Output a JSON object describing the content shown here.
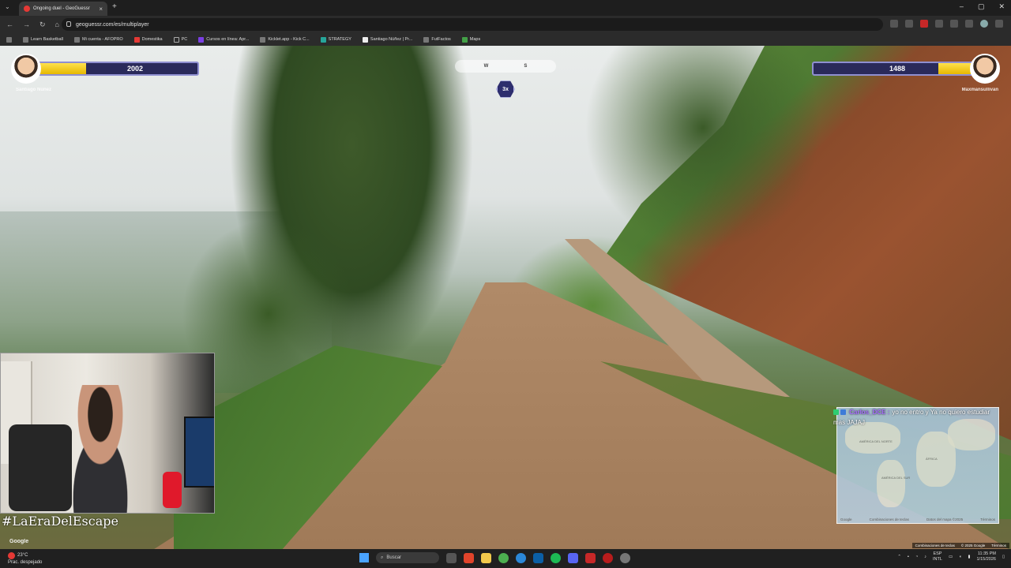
{
  "browser": {
    "tab_title": "Ongoing duel - GeoGuessr",
    "url": "geoguessr.com/es/multiplayer",
    "bookmarks": [
      "Learn Basketball",
      "Mi cuenta - AFOPRO",
      "Domestika",
      "PC",
      "Cursos en línea: Apr...",
      "Kicklet.app - Kick C...",
      "STRATEGY",
      "Santiago Núñez | Pr...",
      "FutFactos",
      "Maps"
    ]
  },
  "duel": {
    "left_player": {
      "name": "Santiago Núñez",
      "health": "2002",
      "health_fraction": 0.3
    },
    "right_player": {
      "name": "Maxmansullivan",
      "health": "1488",
      "health_fraction": 0.22
    },
    "compass": {
      "left": "W",
      "center": "S"
    },
    "multiplier": "3x"
  },
  "overlay": {
    "hashtag": "#LaEraDelEscape",
    "google_left": "Google",
    "chat": {
      "user": "Carlos_DCE :",
      "message": "yo no entro y Ya no quiero estudiar mas JAJAJ"
    },
    "map_footer": {
      "google": "Google",
      "shortcuts": "Combinaciones de teclas",
      "mapdata": "Datos del mapa ©2025",
      "terms": "Términos"
    },
    "map_labels": {
      "na": "AMÉRICA DEL NORTE",
      "sa": "AMÉRICA DEL SUR",
      "africa": "ÁFRICA"
    },
    "streetview_footer": {
      "shortcuts": "Combinaciones de teclas",
      "copyright": "© 2025 Google",
      "terms": "Términos"
    }
  },
  "taskbar": {
    "weather_temp": "23°C",
    "weather_desc": "Prac. despejado",
    "search_placeholder": "Buscar",
    "lang_1": "ESP",
    "lang_2": "INTL",
    "time": "11:35 PM",
    "date": "1/15/2026"
  },
  "colors": {
    "health_fill": "#e6b800",
    "health_bg": "#2a2a5a",
    "chat_user": "#a970ff"
  }
}
